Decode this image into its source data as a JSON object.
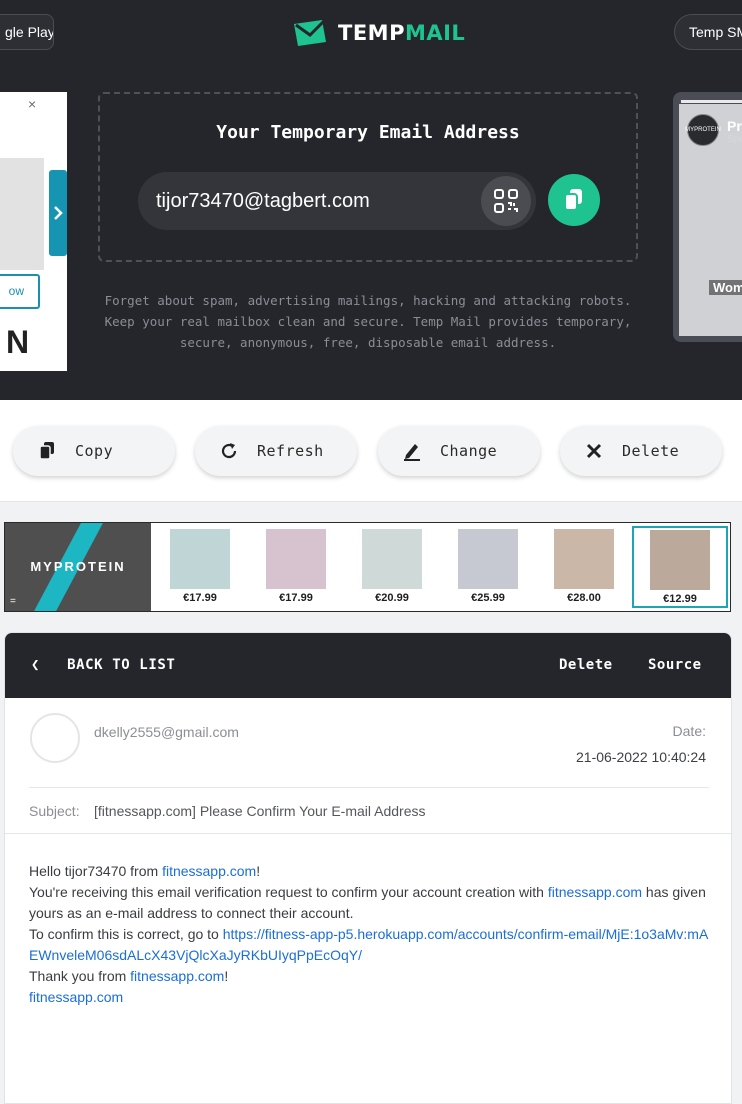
{
  "header": {
    "store_pill_left": "gle Play",
    "logo_part1": "TEMP",
    "logo_part2": "MAIL",
    "pill_right": "Temp SM"
  },
  "left_ad": {
    "close": "×",
    "button": "ow",
    "letter": "N"
  },
  "right_ad": {
    "avatar_text": "MYPROTEIN",
    "title": "Pr",
    "subtitle": "Spo",
    "label": "Wom"
  },
  "email_box": {
    "title": "Your Temporary Email Address",
    "address": "tijor73470@tagbert.com"
  },
  "hero": {
    "description_line1": "Forget about spam, advertising mailings, hacking and attacking robots.",
    "description_line2": "Keep your real mailbox clean and secure. Temp Mail provides temporary,",
    "description_line3": "secure, anonymous, free, disposable email address."
  },
  "actions": [
    {
      "label": "Copy"
    },
    {
      "label": "Refresh"
    },
    {
      "label": "Change"
    },
    {
      "label": "Delete"
    }
  ],
  "banner": {
    "brand": "MYPROTEIN",
    "menu_glyph": "=",
    "prices": [
      "€17.99",
      "€17.99",
      "€20.99",
      "€25.99",
      "€28.00",
      "€12.99"
    ]
  },
  "message": {
    "back_label": "BACK TO LIST",
    "delete_label": "Delete",
    "source_label": "Source",
    "sender": "dkelly2555@gmail.com",
    "date_label": "Date:",
    "date_value": "21-06-2022 10:40:24",
    "subject_label": "Subject:",
    "subject": "[fitnessapp.com] Please Confirm Your E-mail Address",
    "body": {
      "greeting_prefix": "Hello tijor73470 from ",
      "site": "fitnessapp.com",
      "exclaim": "!",
      "line2_prefix": "You're receiving this email verification request to confirm your account creation with ",
      "line2_suffix": " has given yours as an e-mail address to connect their account.",
      "line3_prefix": "To confirm this is correct, go to ",
      "confirm_link": "https://fitness-app-p5.herokuapp.com/accounts/confirm-email/MjE:1o3aMv:mAEWnveleM06sdALcX43VjQlcXaJyRKbUIyqPpEcOqY/",
      "thanks_prefix": "Thank you from "
    }
  },
  "colors": {
    "dark_bg": "#25262b",
    "accent_green": "#1ec38f",
    "link_blue": "#1a6ed8",
    "banner_teal": "#1db7c4"
  }
}
